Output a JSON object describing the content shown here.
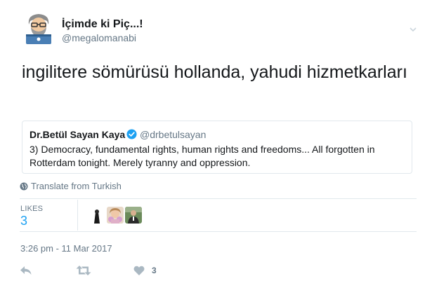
{
  "author": {
    "name": "İçimde ki Piç...!",
    "handle": "@megalomanabi",
    "avatar_icon": "bearded-man-laptop-avatar"
  },
  "tweet": {
    "text": "ingilitere sömürüsü hollanda, yahudi hizmetkarları"
  },
  "quoted_tweet": {
    "author_name": "Dr.Betül Sayan Kaya",
    "verified_icon": "verified-badge-icon",
    "handle": "@drbetulsayan",
    "text": "3) Democracy, fundamental rights, human rights and freedoms... All forgotten in Rotterdam tonight. Merely tyranny and oppression."
  },
  "translate": {
    "label": "Translate from Turkish",
    "icon": "globe-icon"
  },
  "stats": {
    "likes_label": "LIKES",
    "likes_count": "3",
    "likers": [
      {
        "icon": "liker-avatar"
      },
      {
        "icon": "liker-avatar"
      },
      {
        "icon": "liker-avatar"
      }
    ]
  },
  "timestamp": "3:26 pm - 11 Mar 2017",
  "actions": {
    "reply_icon": "reply-icon",
    "retweet_icon": "retweet-icon",
    "like_icon": "heart-icon",
    "like_count": "3"
  },
  "colors": {
    "accent": "#1da1f2",
    "muted": "#657786",
    "text": "#14171a",
    "border": "#e1e8ed",
    "action_icon": "#aab8c2"
  }
}
